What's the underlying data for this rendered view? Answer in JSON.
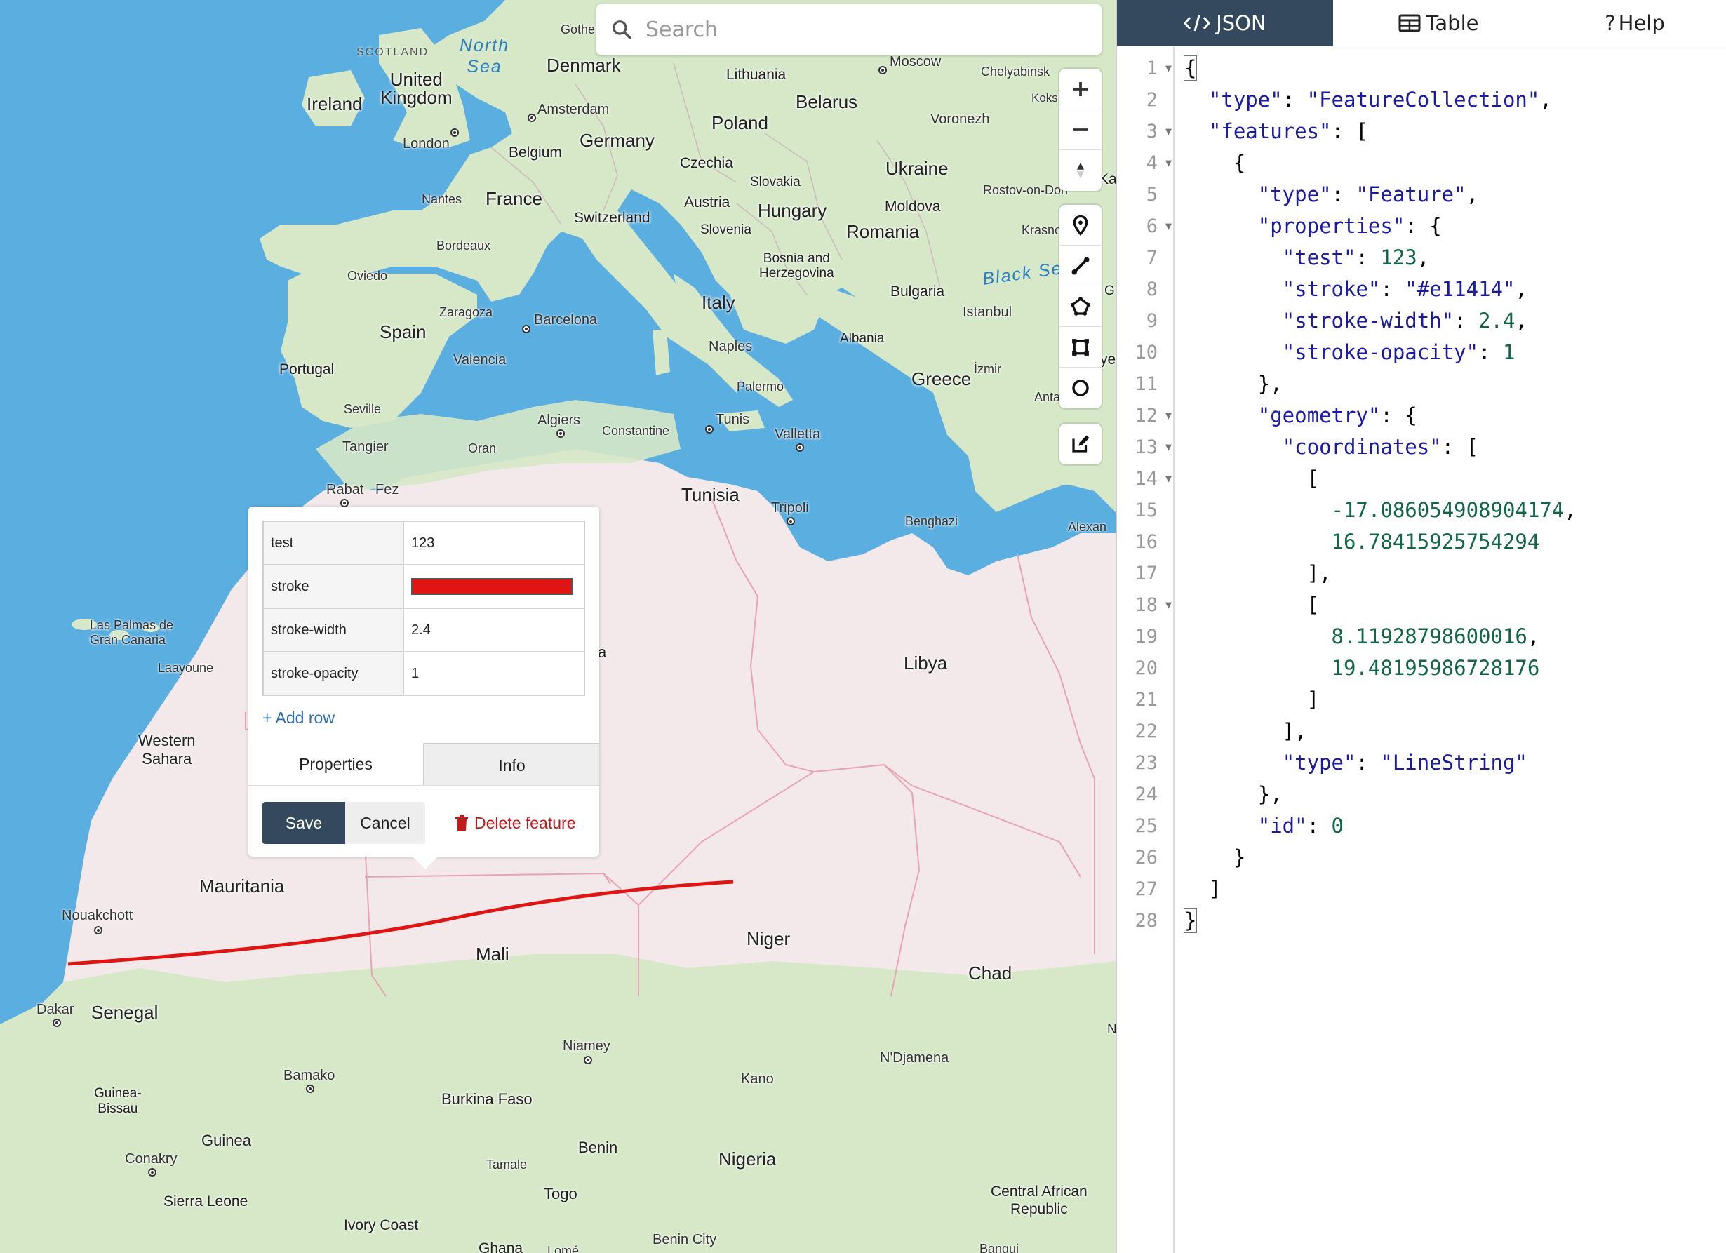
{
  "search": {
    "placeholder": "Search"
  },
  "map": {
    "sea_labels": [
      {
        "text": "North Sea",
        "lines": [
          "North",
          "Sea"
        ]
      },
      {
        "text": "Black Se"
      }
    ],
    "small_caps": [
      "SCOTLAND"
    ],
    "countries": [
      {
        "id": "ireland",
        "text": "Ireland"
      },
      {
        "id": "uk",
        "lines": [
          "United",
          "Kingdom"
        ]
      },
      {
        "id": "denmark",
        "text": "Denmark"
      },
      {
        "id": "lithuania",
        "text": "Lithuania"
      },
      {
        "id": "belarus",
        "text": "Belarus"
      },
      {
        "id": "poland",
        "text": "Poland"
      },
      {
        "id": "germany",
        "text": "Germany"
      },
      {
        "id": "belgium",
        "text": "Belgium"
      },
      {
        "id": "czechia",
        "text": "Czechia"
      },
      {
        "id": "slovakia",
        "text": "Slovakia"
      },
      {
        "id": "ukraine",
        "text": "Ukraine"
      },
      {
        "id": "france",
        "text": "France"
      },
      {
        "id": "austria",
        "text": "Austria"
      },
      {
        "id": "hungary",
        "text": "Hungary"
      },
      {
        "id": "moldova",
        "text": "Moldova"
      },
      {
        "id": "switzerland",
        "text": "Switzerland"
      },
      {
        "id": "slovenia",
        "text": "Slovenia"
      },
      {
        "id": "romania",
        "text": "Romania"
      },
      {
        "id": "bosnia",
        "lines": [
          "Bosnia and",
          "Herzegovina"
        ]
      },
      {
        "id": "bulgaria",
        "text": "Bulgaria"
      },
      {
        "id": "italy",
        "text": "Italy"
      },
      {
        "id": "spain",
        "text": "Spain"
      },
      {
        "id": "portugal",
        "text": "Portugal"
      },
      {
        "id": "albania",
        "text": "Albania"
      },
      {
        "id": "greece",
        "text": "Greece"
      },
      {
        "id": "tunisia",
        "text": "Tunisia"
      },
      {
        "id": "libya",
        "text": "Libya"
      },
      {
        "id": "western-sahara",
        "lines": [
          "Western",
          "Sahara"
        ]
      },
      {
        "id": "mauritania",
        "text": "Mauritania"
      },
      {
        "id": "mali",
        "text": "Mali"
      },
      {
        "id": "niger",
        "text": "Niger"
      },
      {
        "id": "chad",
        "text": "Chad"
      },
      {
        "id": "senegal",
        "text": "Senegal"
      },
      {
        "id": "guinea-bissau",
        "lines": [
          "Guinea-",
          "Bissau"
        ]
      },
      {
        "id": "burkina-faso",
        "text": "Burkina Faso"
      },
      {
        "id": "guinea",
        "text": "Guinea"
      },
      {
        "id": "benin",
        "text": "Benin"
      },
      {
        "id": "nigeria",
        "text": "Nigeria"
      },
      {
        "id": "togo",
        "text": "Togo"
      },
      {
        "id": "sierra-leone",
        "text": "Sierra Leone"
      },
      {
        "id": "ivory-coast",
        "text": "Ivory Coast"
      },
      {
        "id": "ghana",
        "text": "Ghana"
      },
      {
        "id": "car",
        "lines": [
          "Central African",
          "Republic"
        ]
      },
      {
        "id": "partial-a",
        "text": "a"
      },
      {
        "id": "partial-ka",
        "text": "Ka"
      },
      {
        "id": "partial-g",
        "text": "G"
      },
      {
        "id": "partial-ye",
        "text": "ye"
      },
      {
        "id": "partial-n",
        "text": "N"
      }
    ],
    "cities": [
      {
        "id": "gothenburg",
        "text": "Gother"
      },
      {
        "id": "moscow",
        "text": "Moscow"
      },
      {
        "id": "chelyabinsk",
        "text": "Chelyabinsk"
      },
      {
        "id": "koksh",
        "text": "Koksh"
      },
      {
        "id": "amsterdam",
        "text": "Amsterdam"
      },
      {
        "id": "voronezh",
        "text": "Voronezh"
      },
      {
        "id": "london",
        "text": "London"
      },
      {
        "id": "nantes",
        "text": "Nantes"
      },
      {
        "id": "rostov",
        "text": "Rostov-on-Don"
      },
      {
        "id": "krasno",
        "text": "Krasno"
      },
      {
        "id": "bordeaux",
        "text": "Bordeaux"
      },
      {
        "id": "oviedo",
        "text": "Oviedo"
      },
      {
        "id": "zaragoza",
        "text": "Zaragoza"
      },
      {
        "id": "barcelona",
        "text": "Barcelona"
      },
      {
        "id": "istanbul",
        "text": "Istanbul"
      },
      {
        "id": "valencia",
        "text": "Valencia"
      },
      {
        "id": "naples",
        "text": "Naples"
      },
      {
        "id": "izmir",
        "text": "İzmir"
      },
      {
        "id": "palermo",
        "text": "Palermo"
      },
      {
        "id": "anta",
        "text": "Anta"
      },
      {
        "id": "seville",
        "text": "Seville"
      },
      {
        "id": "algiers",
        "text": "Algiers"
      },
      {
        "id": "tunis",
        "text": "Tunis"
      },
      {
        "id": "constantine",
        "text": "Constantine"
      },
      {
        "id": "valletta",
        "text": "Valletta"
      },
      {
        "id": "tangier",
        "text": "Tangier"
      },
      {
        "id": "oran",
        "text": "Oran"
      },
      {
        "id": "rabat",
        "text": "Rabat"
      },
      {
        "id": "fez",
        "text": "Fez"
      },
      {
        "id": "tripoli",
        "text": "Tripoli"
      },
      {
        "id": "benghazi",
        "text": "Benghazi"
      },
      {
        "id": "alexandria",
        "text": "Alexan"
      },
      {
        "id": "las-palmas",
        "lines": [
          "Las Palmas de",
          "Gran Canaria"
        ]
      },
      {
        "id": "laayoune",
        "text": "Laayoune"
      },
      {
        "id": "nouakchott",
        "text": "Nouakchott"
      },
      {
        "id": "dakar",
        "text": "Dakar"
      },
      {
        "id": "niamey",
        "text": "Niamey"
      },
      {
        "id": "ndjamena",
        "text": "N'Djamena"
      },
      {
        "id": "bamako",
        "text": "Bamako"
      },
      {
        "id": "kano",
        "text": "Kano"
      },
      {
        "id": "conakry",
        "text": "Conakry"
      },
      {
        "id": "tamale",
        "text": "Tamale"
      },
      {
        "id": "benin-city",
        "text": "Benin City"
      },
      {
        "id": "lome",
        "text": "Lomé"
      },
      {
        "id": "bangui",
        "text": "Bangui"
      }
    ]
  },
  "controls": {
    "zoom_in": "zoom-in",
    "zoom_out": "zoom-out",
    "compass": "reset-bearing",
    "draw_tools": [
      "draw-point",
      "draw-line",
      "draw-polygon",
      "draw-rectangle",
      "draw-circle"
    ],
    "edit": "edit-features"
  },
  "feature_line": {
    "color": "#e11414"
  },
  "popup": {
    "rows": [
      {
        "key": "test",
        "value": "123"
      },
      {
        "key": "stroke",
        "value": "#e11414",
        "is_color": true
      },
      {
        "key": "stroke-width",
        "value": "2.4"
      },
      {
        "key": "stroke-opacity",
        "value": "1"
      }
    ],
    "add_row_label": "+ Add row",
    "tabs": [
      {
        "label": "Properties",
        "active": true
      },
      {
        "label": "Info",
        "active": false
      }
    ],
    "save_label": "Save",
    "cancel_label": "Cancel",
    "delete_label": "Delete feature"
  },
  "panel": {
    "tabs": [
      {
        "label": "JSON",
        "icon": "code-icon",
        "active": true
      },
      {
        "label": "Table",
        "icon": "table-icon",
        "active": false
      },
      {
        "label": "Help",
        "icon": "question-icon",
        "active": false
      }
    ],
    "editor": {
      "lines": [
        {
          "n": "1",
          "fold": true,
          "text": "{"
        },
        {
          "n": "2",
          "fold": false,
          "text": "  \"type\": \"FeatureCollection\","
        },
        {
          "n": "3",
          "fold": true,
          "text": "  \"features\": ["
        },
        {
          "n": "4",
          "fold": true,
          "text": "    {"
        },
        {
          "n": "5",
          "fold": false,
          "text": "      \"type\": \"Feature\","
        },
        {
          "n": "6",
          "fold": true,
          "text": "      \"properties\": {"
        },
        {
          "n": "7",
          "fold": false,
          "text": "        \"test\": 123,"
        },
        {
          "n": "8",
          "fold": false,
          "text": "        \"stroke\": \"#e11414\","
        },
        {
          "n": "9",
          "fold": false,
          "text": "        \"stroke-width\": 2.4,"
        },
        {
          "n": "10",
          "fold": false,
          "text": "        \"stroke-opacity\": 1"
        },
        {
          "n": "11",
          "fold": false,
          "text": "      },"
        },
        {
          "n": "12",
          "fold": true,
          "text": "      \"geometry\": {"
        },
        {
          "n": "13",
          "fold": true,
          "text": "        \"coordinates\": ["
        },
        {
          "n": "14",
          "fold": true,
          "text": "          ["
        },
        {
          "n": "15",
          "fold": false,
          "text": "            -17.086054908904174,"
        },
        {
          "n": "16",
          "fold": false,
          "text": "            16.78415925754294"
        },
        {
          "n": "17",
          "fold": false,
          "text": "          ],"
        },
        {
          "n": "18",
          "fold": true,
          "text": "          ["
        },
        {
          "n": "19",
          "fold": false,
          "text": "            8.11928798600016,"
        },
        {
          "n": "20",
          "fold": false,
          "text": "            19.48195986728176"
        },
        {
          "n": "21",
          "fold": false,
          "text": "          ]"
        },
        {
          "n": "22",
          "fold": false,
          "text": "        ],"
        },
        {
          "n": "23",
          "fold": false,
          "text": "        \"type\": \"LineString\""
        },
        {
          "n": "24",
          "fold": false,
          "text": "      },"
        },
        {
          "n": "25",
          "fold": false,
          "text": "      \"id\": 0"
        },
        {
          "n": "26",
          "fold": false,
          "text": "    }"
        },
        {
          "n": "27",
          "fold": false,
          "text": "  ]"
        },
        {
          "n": "28",
          "fold": false,
          "text": "}"
        }
      ]
    }
  }
}
